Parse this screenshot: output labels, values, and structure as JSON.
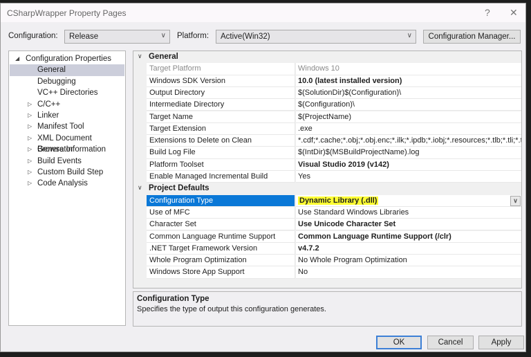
{
  "window": {
    "title": "CSharpWrapper Property Pages",
    "help_icon": "?",
    "close_icon": "✕"
  },
  "toolbar": {
    "configuration_label": "Configuration:",
    "configuration_value": "Release",
    "platform_label": "Platform:",
    "platform_value": "Active(Win32)",
    "config_manager_label": "Configuration Manager..."
  },
  "tree": {
    "root": "Configuration Properties",
    "items": [
      {
        "label": "General",
        "expandable": false,
        "selected": true
      },
      {
        "label": "Debugging",
        "expandable": false
      },
      {
        "label": "VC++ Directories",
        "expandable": false
      },
      {
        "label": "C/C++",
        "expandable": true
      },
      {
        "label": "Linker",
        "expandable": true
      },
      {
        "label": "Manifest Tool",
        "expandable": true
      },
      {
        "label": "XML Document Generator",
        "expandable": true
      },
      {
        "label": "Browse Information",
        "expandable": true
      },
      {
        "label": "Build Events",
        "expandable": true
      },
      {
        "label": "Custom Build Step",
        "expandable": true
      },
      {
        "label": "Code Analysis",
        "expandable": true
      }
    ]
  },
  "grid": {
    "sections": [
      {
        "title": "General",
        "rows": [
          {
            "name": "Target Platform",
            "value": "Windows 10",
            "dim": true
          },
          {
            "name": "Windows SDK Version",
            "value": "10.0 (latest installed version)",
            "bold": true
          },
          {
            "name": "Output Directory",
            "value": "$(SolutionDir)$(Configuration)\\"
          },
          {
            "name": "Intermediate Directory",
            "value": "$(Configuration)\\"
          },
          {
            "name": "Target Name",
            "value": "$(ProjectName)"
          },
          {
            "name": "Target Extension",
            "value": ".exe"
          },
          {
            "name": "Extensions to Delete on Clean",
            "value": "*.cdf;*.cache;*.obj;*.obj.enc;*.ilk;*.ipdb;*.iobj;*.resources;*.tlb;*.tli;*.t"
          },
          {
            "name": "Build Log File",
            "value": "$(IntDir)$(MSBuildProjectName).log"
          },
          {
            "name": "Platform Toolset",
            "value": "Visual Studio 2019 (v142)",
            "bold": true
          },
          {
            "name": "Enable Managed Incremental Build",
            "value": "Yes"
          }
        ]
      },
      {
        "title": "Project Defaults",
        "rows": [
          {
            "name": "Configuration Type",
            "value": "Dynamic Library (.dll)",
            "bold": true,
            "selected": true,
            "highlighted": true
          },
          {
            "name": "Use of MFC",
            "value": "Use Standard Windows Libraries"
          },
          {
            "name": "Character Set",
            "value": "Use Unicode Character Set",
            "bold": true
          },
          {
            "name": "Common Language Runtime Support",
            "value": "Common Language Runtime Support (/clr)",
            "bold": true
          },
          {
            "name": ".NET Target Framework Version",
            "value": "v4.7.2",
            "bold": true
          },
          {
            "name": "Whole Program Optimization",
            "value": "No Whole Program Optimization"
          },
          {
            "name": "Windows Store App Support",
            "value": "No"
          }
        ]
      }
    ]
  },
  "description": {
    "title": "Configuration Type",
    "text": "Specifies the type of output this configuration generates."
  },
  "buttons": {
    "ok": "OK",
    "cancel": "Cancel",
    "apply": "Apply"
  },
  "colors": {
    "selection": "#0a78d7",
    "highlight": "#ffff33",
    "default_button_border": "#3c7fd6"
  }
}
